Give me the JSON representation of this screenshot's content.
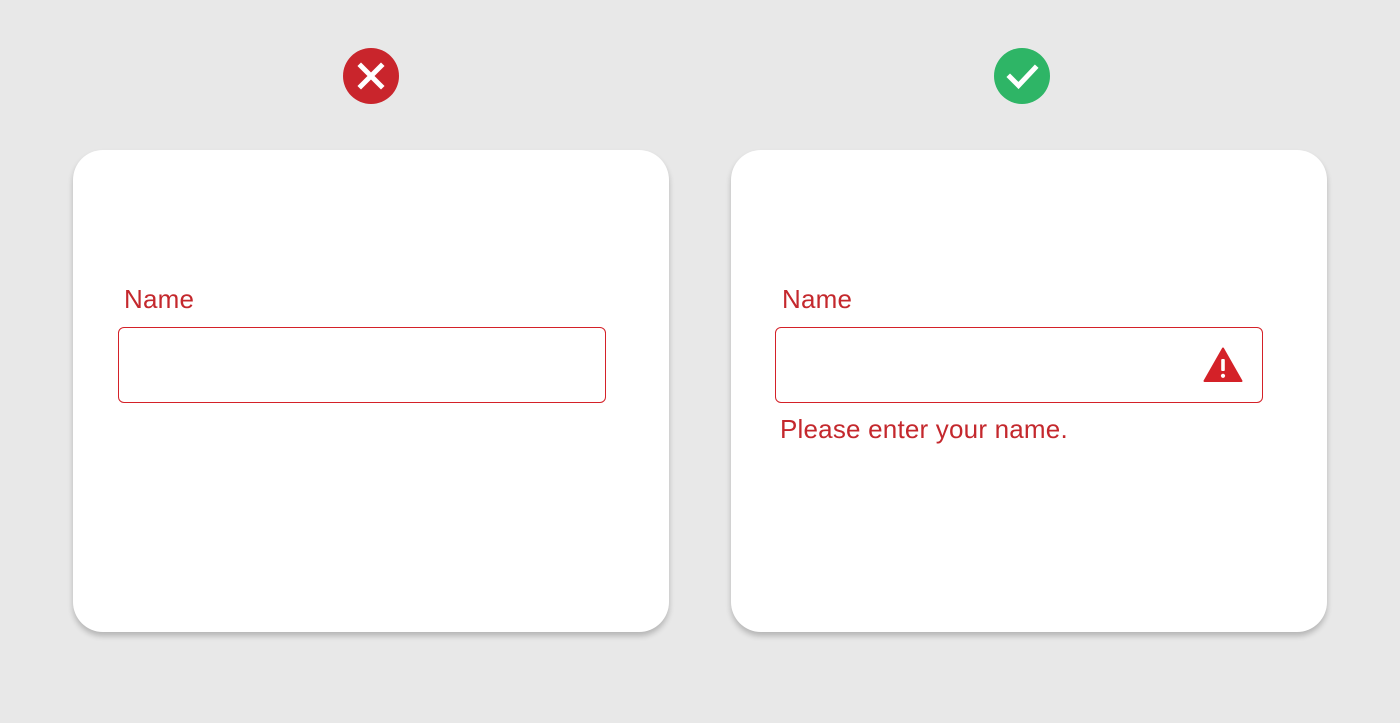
{
  "examples": {
    "wrong": {
      "badge_icon": "close-icon",
      "badge_color": "#c9252c",
      "field": {
        "label": "Name",
        "value": "",
        "placeholder": ""
      }
    },
    "right": {
      "badge_icon": "check-icon",
      "badge_color": "#2eb566",
      "field": {
        "label": "Name",
        "value": "",
        "placeholder": "",
        "status_icon": "warning-icon",
        "error_message": "Please enter your name."
      }
    }
  },
  "colors": {
    "background": "#e8e8e8",
    "card": "#ffffff",
    "error": "#c4282d",
    "input_border": "#d42128",
    "success": "#2eb566"
  }
}
